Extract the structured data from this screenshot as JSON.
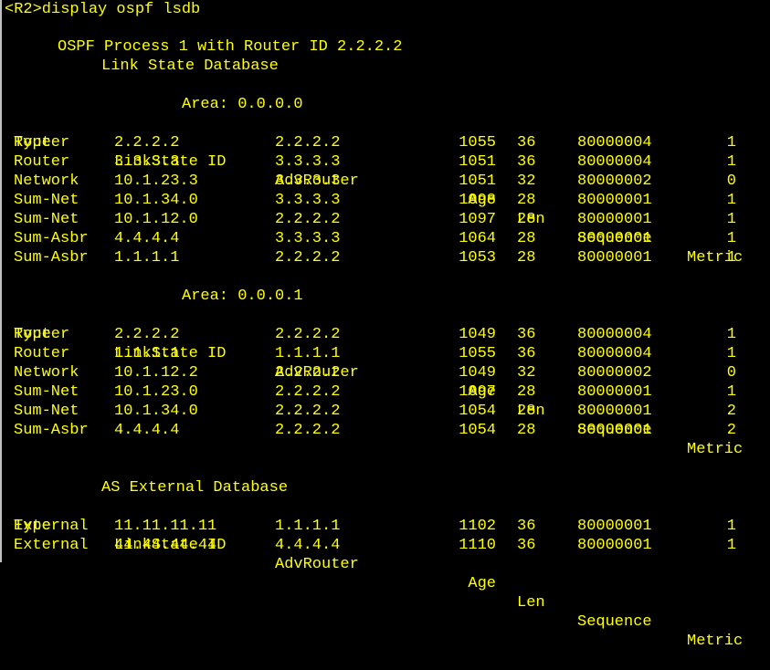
{
  "prompt": "<R2>display ospf lsdb",
  "process_line": "OSPF Process 1 with Router ID 2.2.2.2",
  "db_title": "Link State Database",
  "headers": {
    "type": "Type",
    "lsid": "LinkState ID",
    "adv": "AdvRouter",
    "age": "Age",
    "len": "Len",
    "seq": "Sequence",
    "metric": "Metric"
  },
  "areas": [
    {
      "title": "Area: 0.0.0.0",
      "rows": [
        {
          "type": "Router",
          "lsid": "2.2.2.2",
          "adv": "2.2.2.2",
          "age": "1055",
          "len": "36",
          "seq": "80000004",
          "metric": "1"
        },
        {
          "type": "Router",
          "lsid": "3.3.3.3",
          "adv": "3.3.3.3",
          "age": "1051",
          "len": "36",
          "seq": "80000004",
          "metric": "1"
        },
        {
          "type": "Network",
          "lsid": "10.1.23.3",
          "adv": "3.3.3.3",
          "age": "1051",
          "len": "32",
          "seq": "80000002",
          "metric": "0"
        },
        {
          "type": "Sum-Net",
          "lsid": "10.1.34.0",
          "adv": "3.3.3.3",
          "age": "1098",
          "len": "28",
          "seq": "80000001",
          "metric": "1"
        },
        {
          "type": "Sum-Net",
          "lsid": "10.1.12.0",
          "adv": "2.2.2.2",
          "age": "1097",
          "len": "28",
          "seq": "80000001",
          "metric": "1"
        },
        {
          "type": "Sum-Asbr",
          "lsid": "4.4.4.4",
          "adv": "3.3.3.3",
          "age": "1064",
          "len": "28",
          "seq": "80000001",
          "metric": "1"
        },
        {
          "type": "Sum-Asbr",
          "lsid": "1.1.1.1",
          "adv": "2.2.2.2",
          "age": "1053",
          "len": "28",
          "seq": "80000001",
          "metric": "1"
        }
      ]
    },
    {
      "title": "Area: 0.0.0.1",
      "rows": [
        {
          "type": "Router",
          "lsid": "2.2.2.2",
          "adv": "2.2.2.2",
          "age": "1049",
          "len": "36",
          "seq": "80000004",
          "metric": "1"
        },
        {
          "type": "Router",
          "lsid": "1.1.1.1",
          "adv": "1.1.1.1",
          "age": "1055",
          "len": "36",
          "seq": "80000004",
          "metric": "1"
        },
        {
          "type": "Network",
          "lsid": "10.1.12.2",
          "adv": "2.2.2.2",
          "age": "1049",
          "len": "32",
          "seq": "80000002",
          "metric": "0"
        },
        {
          "type": "Sum-Net",
          "lsid": "10.1.23.0",
          "adv": "2.2.2.2",
          "age": "1097",
          "len": "28",
          "seq": "80000001",
          "metric": "1"
        },
        {
          "type": "Sum-Net",
          "lsid": "10.1.34.0",
          "adv": "2.2.2.2",
          "age": "1054",
          "len": "28",
          "seq": "80000001",
          "metric": "2"
        },
        {
          "type": "Sum-Asbr",
          "lsid": "4.4.4.4",
          "adv": "2.2.2.2",
          "age": "1054",
          "len": "28",
          "seq": "80000001",
          "metric": "2"
        }
      ]
    }
  ],
  "external": {
    "title": "AS External Database",
    "rows": [
      {
        "type": "External",
        "lsid": "11.11.11.11",
        "adv": "1.1.1.1",
        "age": "1102",
        "len": "36",
        "seq": "80000001",
        "metric": "1"
      },
      {
        "type": "External",
        "lsid": "44.44.44.44",
        "adv": "4.4.4.4",
        "age": "1110",
        "len": "36",
        "seq": "80000001",
        "metric": "1"
      }
    ]
  },
  "colors": {
    "background": "#000000",
    "text": "#ffff00",
    "border": "#c0c0c0"
  }
}
